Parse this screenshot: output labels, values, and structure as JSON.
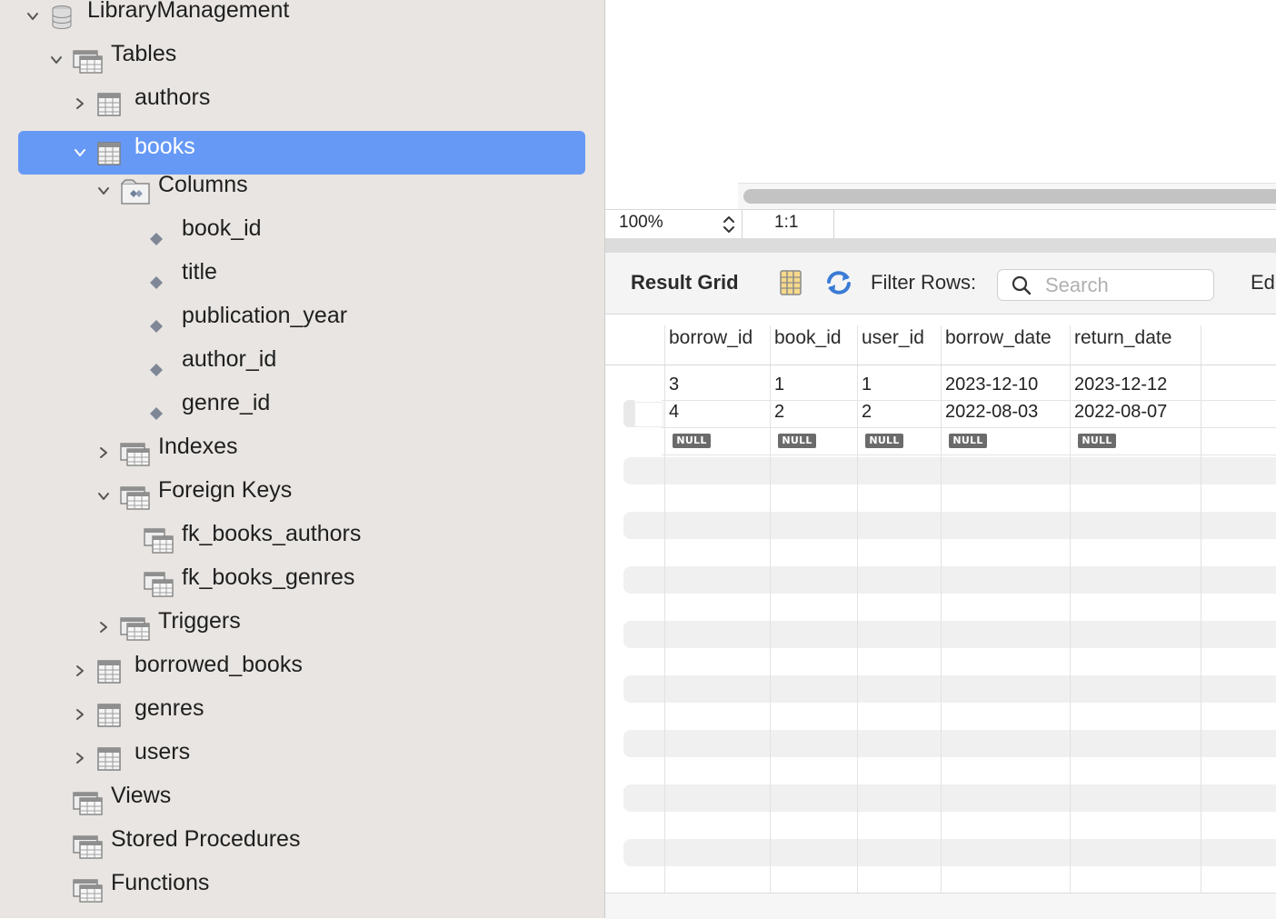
{
  "tree": [
    {
      "id": "schema",
      "label": "LibraryManagement",
      "icon": "database-icon",
      "chevron": "down"
    },
    {
      "id": "tables",
      "label": "Tables",
      "icon": "folder-table-icon",
      "chevron": "down"
    },
    {
      "id": "authors",
      "label": "authors",
      "icon": "table-icon",
      "chevron": "right"
    },
    {
      "id": "books",
      "label": "books",
      "icon": "table-icon",
      "chevron": "down",
      "selected": true
    },
    {
      "id": "columns",
      "label": "Columns",
      "icon": "folder-columns-icon",
      "chevron": "down"
    },
    {
      "id": "col-book_id",
      "label": "book_id",
      "icon": "column-diamond-icon"
    },
    {
      "id": "col-title",
      "label": "title",
      "icon": "column-diamond-icon"
    },
    {
      "id": "col-publication_year",
      "label": "publication_year",
      "icon": "column-diamond-icon"
    },
    {
      "id": "col-author_id",
      "label": "author_id",
      "icon": "column-diamond-icon"
    },
    {
      "id": "col-genre_id",
      "label": "genre_id",
      "icon": "column-diamond-icon"
    },
    {
      "id": "indexes",
      "label": "Indexes",
      "icon": "folder-table-icon",
      "chevron": "right"
    },
    {
      "id": "foreign-keys",
      "label": "Foreign Keys",
      "icon": "folder-table-icon",
      "chevron": "down"
    },
    {
      "id": "fk-books-authors",
      "label": "fk_books_authors",
      "icon": "foreign-key-icon"
    },
    {
      "id": "fk-books-genres",
      "label": "fk_books_genres",
      "icon": "foreign-key-icon"
    },
    {
      "id": "triggers",
      "label": "Triggers",
      "icon": "folder-table-icon",
      "chevron": "right"
    },
    {
      "id": "borrowed_books",
      "label": "borrowed_books",
      "icon": "table-icon",
      "chevron": "right"
    },
    {
      "id": "genres",
      "label": "genres",
      "icon": "table-icon",
      "chevron": "right"
    },
    {
      "id": "users",
      "label": "users",
      "icon": "table-icon",
      "chevron": "right"
    },
    {
      "id": "views",
      "label": "Views",
      "icon": "folder-table-icon"
    },
    {
      "id": "stored-procedures",
      "label": "Stored Procedures",
      "icon": "folder-table-icon"
    },
    {
      "id": "functions",
      "label": "Functions",
      "icon": "folder-table-icon"
    }
  ],
  "status": {
    "zoom": "100%",
    "position": "1:1"
  },
  "result_toolbar": {
    "title": "Result Grid",
    "filter_label": "Filter Rows:",
    "search_placeholder": "Search",
    "edit_label": "Ed"
  },
  "grid": {
    "columns": [
      "borrow_id",
      "book_id",
      "user_id",
      "borrow_date",
      "return_date"
    ],
    "rows": [
      [
        "3",
        "1",
        "1",
        "2023-12-10",
        "2023-12-12"
      ],
      [
        "4",
        "2",
        "2",
        "2022-08-03",
        "2022-08-07"
      ]
    ],
    "null_label": "NULL"
  },
  "colors": {
    "selection": "#6699f5",
    "sidebar_bg": "#e8e5e2"
  }
}
